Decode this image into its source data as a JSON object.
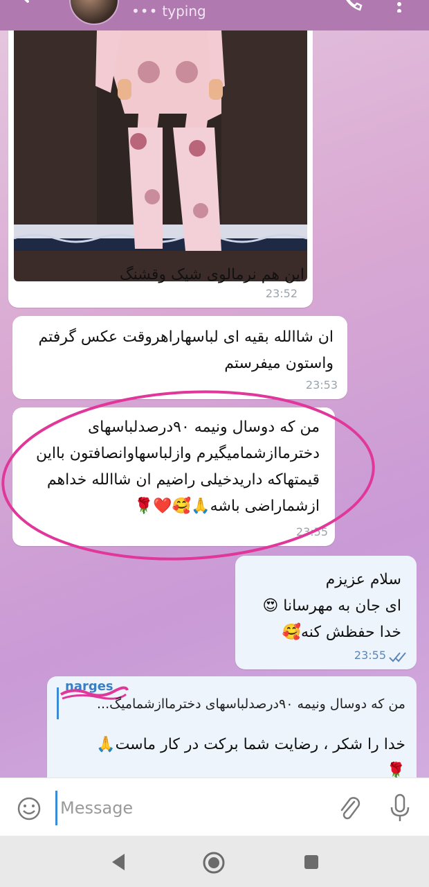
{
  "header": {
    "status": "typing",
    "status_dots": "•••"
  },
  "messages": [
    {
      "text": "این هم نرمالوی شیک وقشنگ",
      "time": "23:52"
    },
    {
      "line1": "ان شاالله بقیه ای لباسهاراهروقت عکس گرفتم",
      "line2": "واستون میفرستم",
      "time": "23:53"
    },
    {
      "line1": "من که دوسال ونیمه ۹۰درصدلباسهای",
      "line2": "دخترمااز‌شمامیگیرم وازلباسهاوانصافتون بااین",
      "line3": "قیمتهاکه داریدخیلی راضیم ان شاالله خداهم",
      "line4": "ازشماراضی باشه",
      "emoji": "🙏🥰❤️🌹",
      "time": "23:55"
    },
    {
      "line1": "سلام عزیزم",
      "line2": "ای جان به مهرسانا",
      "emoji2": "😍",
      "line3": "خدا حفظش کنه",
      "emoji3": "🥰",
      "time": "23:55"
    },
    {
      "reply_name": "narges",
      "reply_preview": "من که دوسال ونیمه ۹۰درصدلباسهای دخترمااز‌شمامیگ...",
      "line1": "خدا را شکر ، رضایت شما برکت در کار ماست",
      "emoji1": "🙏",
      "emoji2": "🌹"
    }
  ],
  "composer": {
    "placeholder": "Message"
  },
  "colors": {
    "header": "#b079b0",
    "outgoing": "#eef4fb",
    "accent": "#3a8bd6",
    "circle": "#e0389a"
  }
}
